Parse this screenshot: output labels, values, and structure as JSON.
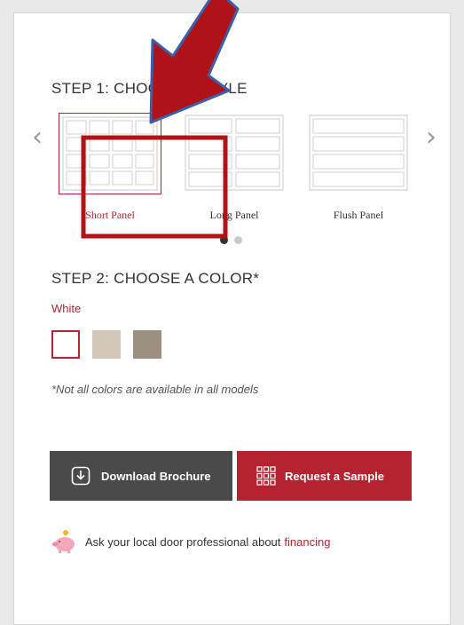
{
  "step1": {
    "title": "STEP 1: CHOOSE A STYLE"
  },
  "styles": [
    {
      "label": "Short Panel",
      "selected": true
    },
    {
      "label": "Long Panel",
      "selected": false
    },
    {
      "label": "Flush Panel",
      "selected": false
    }
  ],
  "carousel": {
    "prev_icon": "chevron-left-icon",
    "next_icon": "chevron-right-icon",
    "active_dot": 0,
    "dot_count": 2
  },
  "step2": {
    "title": "STEP 2: CHOOSE A COLOR*",
    "selected_color": "White"
  },
  "colors": [
    {
      "name": "White",
      "hex": "#ffffff",
      "selected": true
    },
    {
      "name": "",
      "hex": "#d2c7b6"
    },
    {
      "name": "",
      "hex": "#9b8f81"
    }
  ],
  "note": "*Not all colors are available in all models",
  "buttons": {
    "download": {
      "label": "Download Brochure",
      "icon": "download-icon"
    },
    "sample": {
      "label": "Request a Sample",
      "icon": "grid-icon"
    }
  },
  "finance": {
    "text": "Ask your local door professional about",
    "link": "financing",
    "icon": "piggy-bank-icon"
  },
  "colors_theme": {
    "accent": "#b4232f",
    "dark_button": "#4a4a4a",
    "annotation_arrow": "#b01217",
    "arrow_outline": "#3b5fa8"
  }
}
